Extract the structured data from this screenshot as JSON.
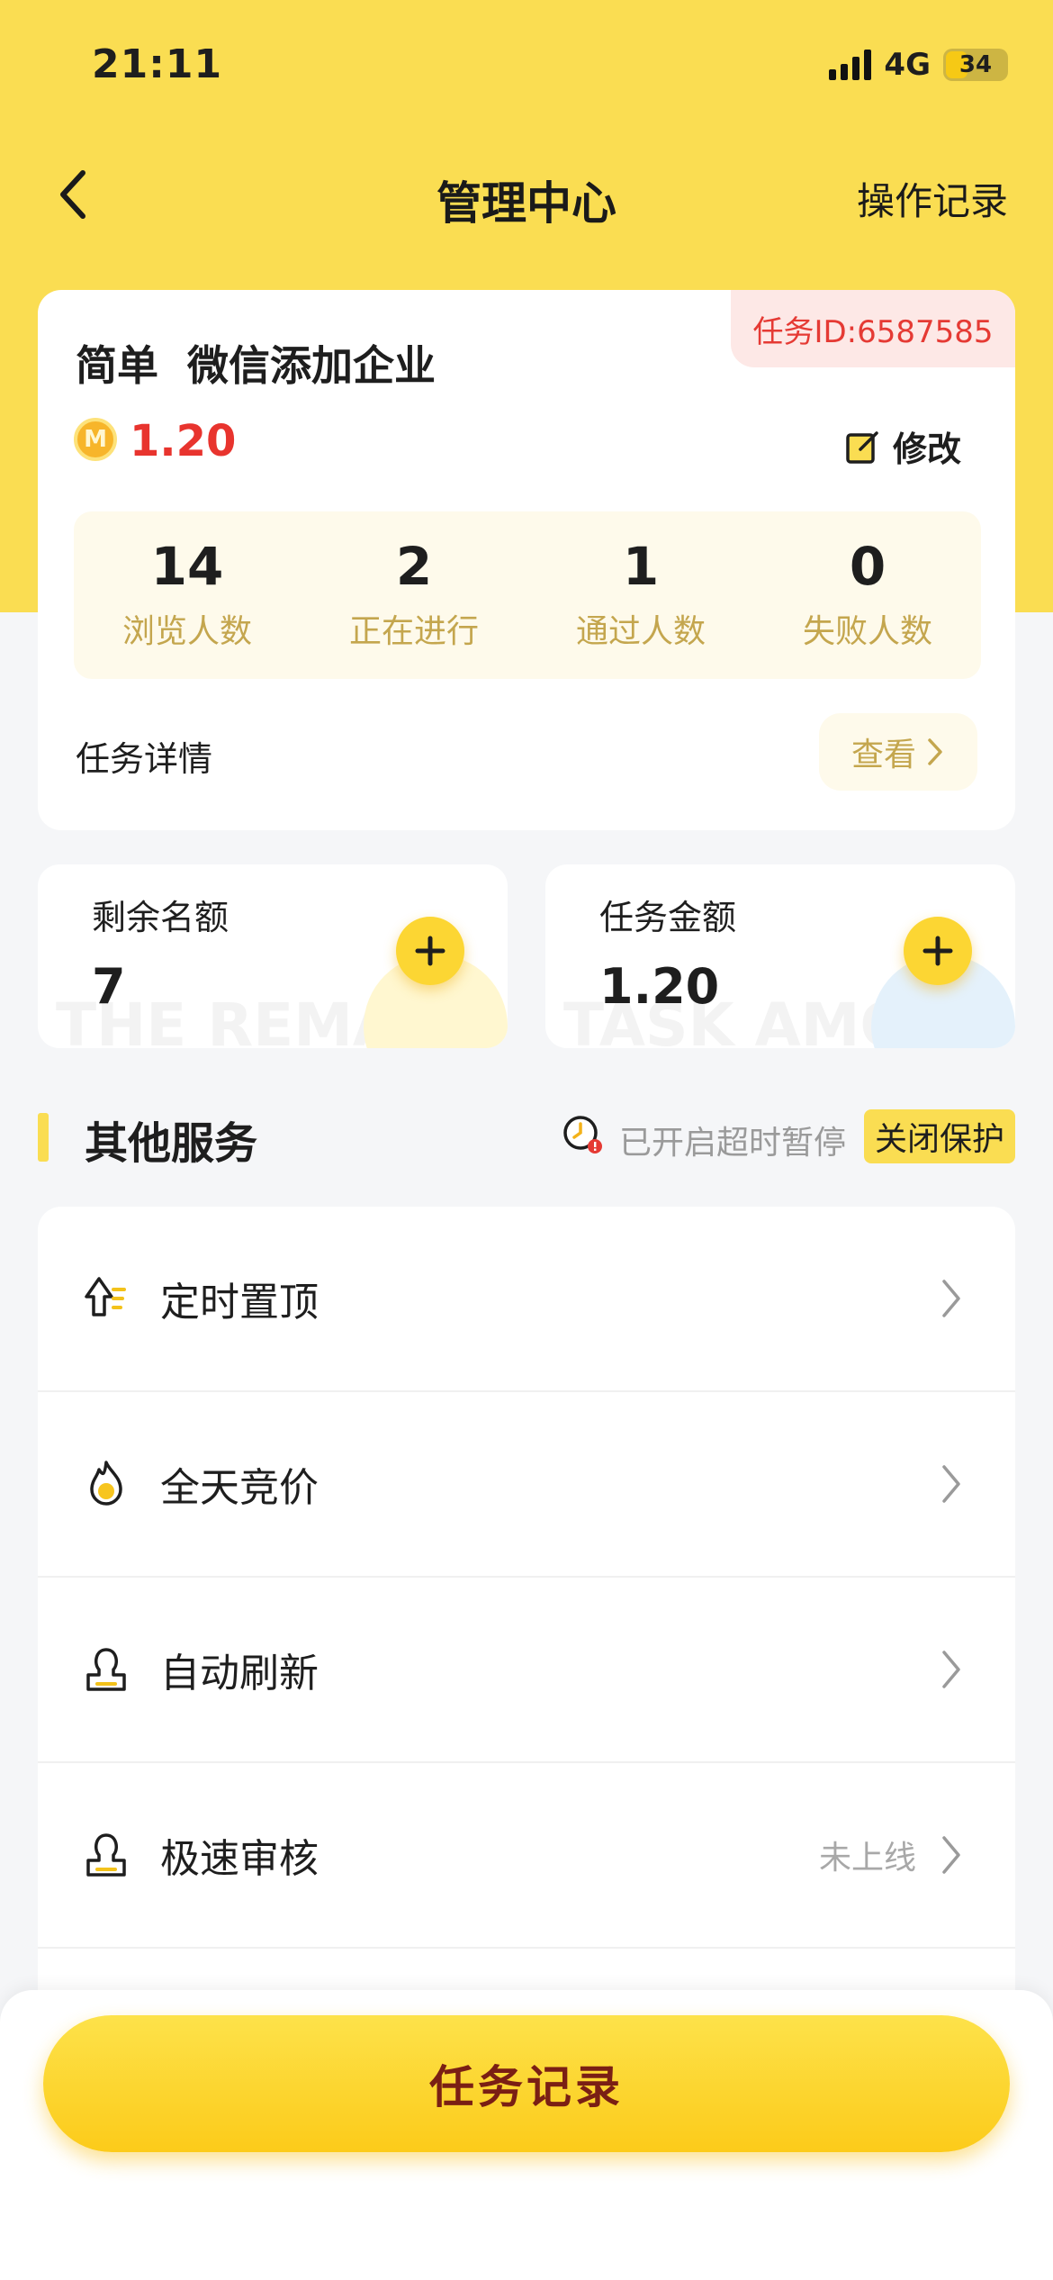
{
  "status_bar": {
    "time": "21:11",
    "network": "4G",
    "battery": "34"
  },
  "nav": {
    "title": "管理中心",
    "right_action": "操作记录"
  },
  "task": {
    "id_badge": "任务ID:6587585",
    "title": "简单  微信添加企业",
    "coin_letter": "M",
    "price": "1.20",
    "edit_label": "修改",
    "stats": [
      {
        "value": "14",
        "label": "浏览人数"
      },
      {
        "value": "2",
        "label": "正在进行"
      },
      {
        "value": "1",
        "label": "通过人数"
      },
      {
        "value": "0",
        "label": "失败人数"
      }
    ],
    "detail_label": "任务详情",
    "view_label": "查看"
  },
  "quota_card": {
    "label": "剩余名额",
    "value": "7",
    "watermark": "THE REMAIN"
  },
  "amount_card": {
    "label": "任务金额",
    "value": "1.20",
    "watermark": "TASK AMOU"
  },
  "services": {
    "title": "其他服务",
    "timeout_text": "已开启超时暂停",
    "protect_label": "关闭保护",
    "items": [
      {
        "label": "定时置顶",
        "icon": "pin-top-icon",
        "status": ""
      },
      {
        "label": "全天竞价",
        "icon": "flame-icon",
        "status": ""
      },
      {
        "label": "自动刷新",
        "icon": "stamp-icon",
        "status": ""
      },
      {
        "label": "极速审核",
        "icon": "stamp-icon",
        "status": "未上线"
      }
    ]
  },
  "bottom": {
    "button_label": "任务记录"
  },
  "colors": {
    "brand_yellow": "#fadd52",
    "price_red": "#e8342e",
    "badge_red": "#e53a34",
    "stat_label": "#c4a64e"
  }
}
